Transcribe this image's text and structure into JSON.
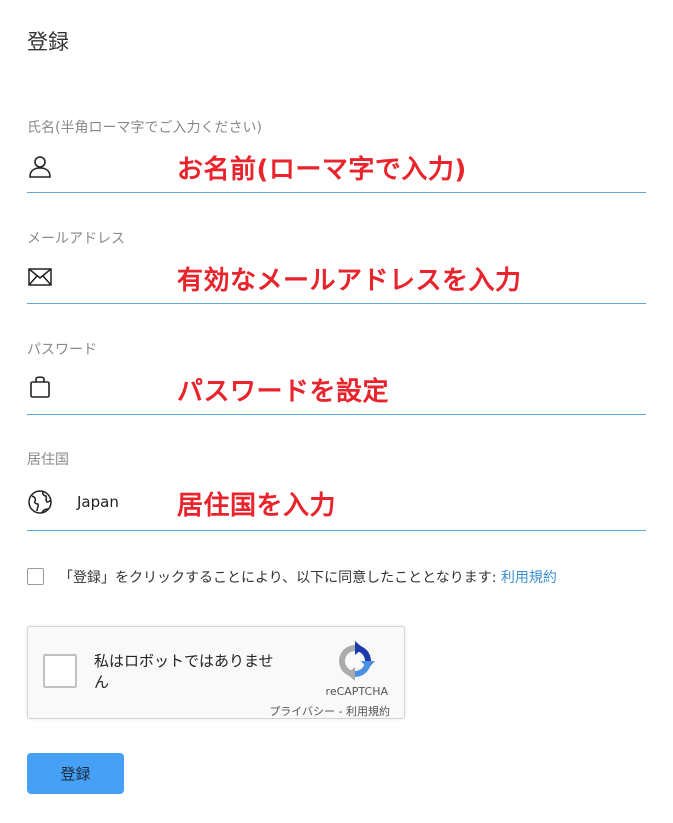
{
  "page": {
    "title": "登録"
  },
  "form": {
    "name": {
      "label": "氏名(半角ローマ字でご入力ください)",
      "annotation": "お名前(ローマ字で入力)"
    },
    "email": {
      "label": "メールアドレス",
      "annotation": "有効なメールアドレスを入力"
    },
    "password": {
      "label": "パスワード",
      "annotation": "パスワードを設定"
    },
    "country": {
      "label": "居住国",
      "value": "Japan",
      "annotation": "居住国を入力"
    }
  },
  "agreement": {
    "text": "「登録」をクリックすることにより、以下に同意したこととなります: ",
    "link": "利用規約"
  },
  "recaptcha": {
    "label": "私はロボットではありません",
    "brand": "reCAPTCHA",
    "privacy": "プライバシー",
    "separator": " - ",
    "terms": "利用規約"
  },
  "submit": {
    "label": "登録"
  },
  "colors": {
    "annotation": "#e8242c",
    "underline": "#5fa7d8",
    "button": "#46a0f5",
    "link": "#3b8fd4"
  },
  "icons": {
    "name": "user-icon",
    "email": "envelope-icon",
    "password": "bag-icon",
    "country": "globe-icon",
    "recaptcha": "recaptcha-logo-icon"
  }
}
